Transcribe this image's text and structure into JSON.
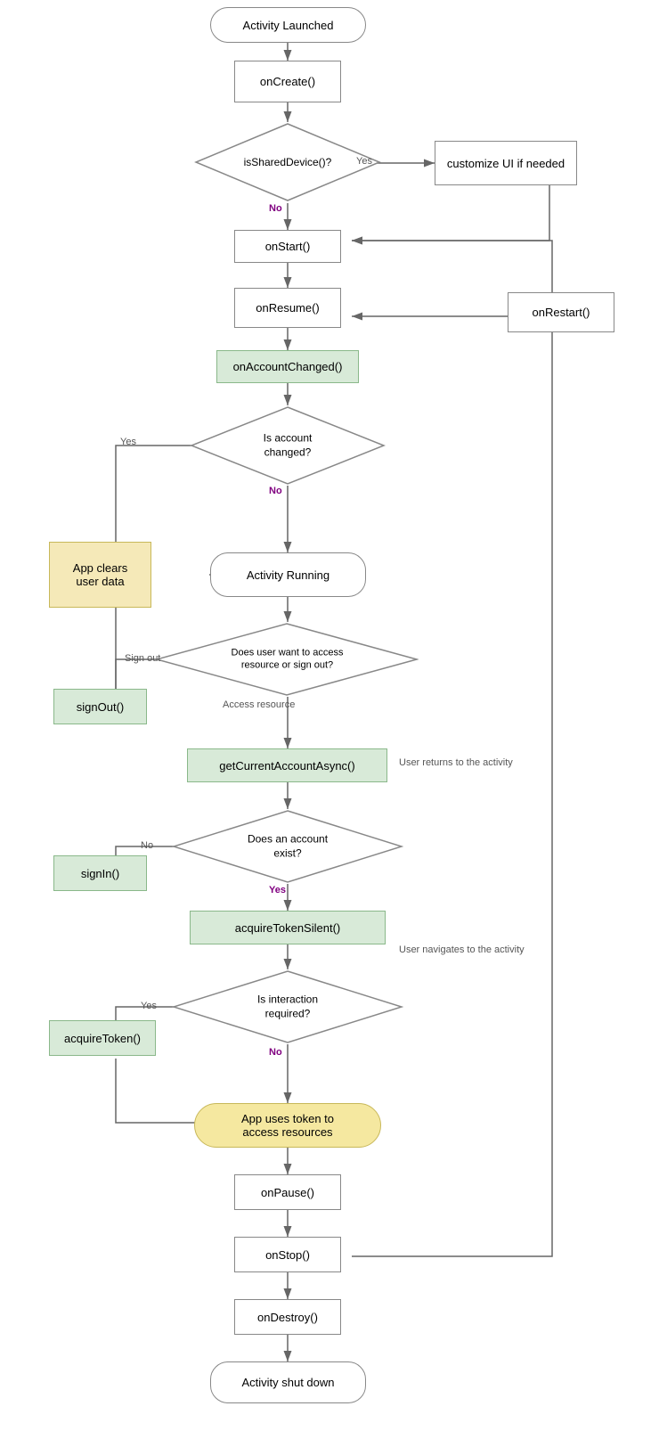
{
  "nodes": {
    "activity_launched": {
      "label": "Activity Launched"
    },
    "on_create": {
      "label": "onCreate()"
    },
    "is_shared_device": {
      "label": "isSharedDevice()?"
    },
    "customize_ui": {
      "label": "customize UI if needed"
    },
    "on_start": {
      "label": "onStart()"
    },
    "on_resume": {
      "label": "onResume()"
    },
    "on_restart": {
      "label": "onRestart()"
    },
    "on_account_changed": {
      "label": "onAccountChanged()"
    },
    "is_account_changed": {
      "label": "Is account\nchanged?"
    },
    "app_clears": {
      "label": "App clears\nuser data"
    },
    "activity_running": {
      "label": "Activity Running"
    },
    "sign_out_fn": {
      "label": "signOut()"
    },
    "does_user_want": {
      "label": "Does user want to access\nresource or sign out?"
    },
    "get_current_account": {
      "label": "getCurrentAccountAsync()"
    },
    "does_account_exist": {
      "label": "Does an account\nexist?"
    },
    "sign_in": {
      "label": "signIn()"
    },
    "acquire_token_silent": {
      "label": "acquireTokenSilent()"
    },
    "is_interaction_required": {
      "label": "Is interaction\nrequired?"
    },
    "acquire_token": {
      "label": "acquireToken()"
    },
    "app_uses_token": {
      "label": "App uses token to\naccess resources"
    },
    "on_pause": {
      "label": "onPause()"
    },
    "on_stop": {
      "label": "onStop()"
    },
    "on_destroy": {
      "label": "onDestroy()"
    },
    "activity_shutdown": {
      "label": "Activity shut down"
    }
  },
  "labels": {
    "yes": "Yes",
    "no": "No",
    "sign_out": "Sign out",
    "access_resource": "Access resource",
    "user_returns": "User returns to the activity",
    "user_navigates": "User navigates to the activity"
  }
}
